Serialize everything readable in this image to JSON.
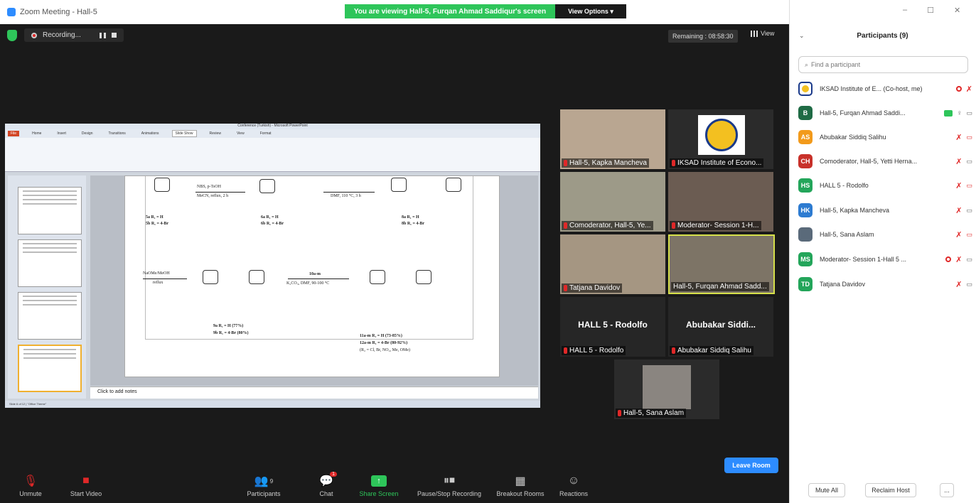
{
  "window": {
    "title": "Zoom Meeting - Hall-5"
  },
  "banner": {
    "text": "You are viewing Hall-5, Furqan Ahmad Saddiqur's screen",
    "view_options": "View Options ▾"
  },
  "recording": {
    "label": "Recording..."
  },
  "remaining": {
    "text": "Remaining : 08:58:30"
  },
  "view": {
    "label": "View"
  },
  "ppt": {
    "title": "Conference (Turkish) - Microsoft PowerPoint",
    "tabs": [
      "File",
      "Home",
      "Insert",
      "Design",
      "Transitions",
      "Animations",
      "Slide Show",
      "Review",
      "View",
      "Format"
    ],
    "notes": "Click to add notes",
    "status": "Slide 6 of 12 | \"Office Theme\""
  },
  "slide": {
    "reagent1": "NBS, p-TsOH",
    "cond1": "MeCN, reflux, 2 h",
    "cond2": "DMF, 110 °C, 3 h",
    "cmpd5": "5a R₁ = H",
    "cmpd5b": "5b R₁ = 4-Br",
    "cmpd6": "6a R₁ = H",
    "cmpd6b": "6b R₁ = 4-Br",
    "cmpd8": "8a R₁ = H",
    "cmpd8b": "8b R₁ = 4-Br",
    "reagent3": "NaOMe/MeOH",
    "cond3": "reflux",
    "reagent4": "10a-m",
    "cond4": "K₂CO₃, DMF, 90-100 °C",
    "cmpd9": "9a R₁ = H (77%)",
    "cmpd9b": "9b R₁ = 4-Br (80%)",
    "cmpd11": "11a-m R₁ = H (73-85%)",
    "cmpd12": "12a-m R₁ = 4-Br (80-92%)",
    "cmpd12r": "(R₂ = Cl, Br, NO₂, Me, OMe)"
  },
  "tiles": [
    {
      "name": "Hall-5, Kapka Mancheva",
      "color": "#b9a691"
    },
    {
      "name": "IKSAD Institute of Econo...",
      "color": "#ffffff"
    },
    {
      "name": "Comoderator, Hall-5, Ye...",
      "color": "#9d9a88"
    },
    {
      "name": "Moderator- Session 1-H...",
      "color": "#6b5c52"
    },
    {
      "name": "Tatjana Davidov",
      "color": "#a59682"
    },
    {
      "name": "Hall-5, Furqan Ahmad Sadd...",
      "color": "#7d7466"
    },
    {
      "name": "HALL 5 - Rodolfo",
      "title": "HALL 5 - Rodolfo",
      "color": "#262626"
    },
    {
      "name": "Abubakar Siddiq Salihu",
      "title": "Abubakar  Siddi...",
      "color": "#262626"
    },
    {
      "name": "Hall-5, Sana Aslam",
      "color": "#8a8580"
    }
  ],
  "toolbar": {
    "unmute": "Unmute",
    "start_video": "Start Video",
    "participants": "Participants",
    "participants_count": "9",
    "chat": "Chat",
    "chat_badge": "1",
    "share": "Share Screen",
    "pause_rec": "Pause/Stop Recording",
    "breakout": "Breakout Rooms",
    "reactions": "Reactions",
    "leave": "Leave Room"
  },
  "panel": {
    "title": "Participants (9)",
    "search_placeholder": "Find a participant",
    "participants": [
      {
        "initials": "",
        "name": "IKSAD Institute of E... (Co-host, me)",
        "color": "#ffffff"
      },
      {
        "initials": "B",
        "name": "Hall-5, Furqan Ahmad Saddi...",
        "color": "#1f6b45"
      },
      {
        "initials": "AS",
        "name": "Abubakar Siddiq Salihu",
        "color": "#f29a1b"
      },
      {
        "initials": "CH",
        "name": "Comoderator, Hall-5, Yetti Herna...",
        "color": "#c8312a"
      },
      {
        "initials": "HS",
        "name": "HALL 5 - Rodolfo",
        "color": "#23a55a"
      },
      {
        "initials": "HK",
        "name": "Hall-5, Kapka Mancheva",
        "color": "#2d7bd1"
      },
      {
        "initials": "",
        "name": "Hall-5, Sana Aslam",
        "color": "#5a6a7a"
      },
      {
        "initials": "MS",
        "name": "Moderator- Session 1-Hall 5 ...",
        "color": "#23a55a"
      },
      {
        "initials": "TD",
        "name": "Tatjana Davidov",
        "color": "#23a55a"
      }
    ],
    "mute_all": "Mute All",
    "reclaim_host": "Reclaim Host",
    "more": "..."
  }
}
